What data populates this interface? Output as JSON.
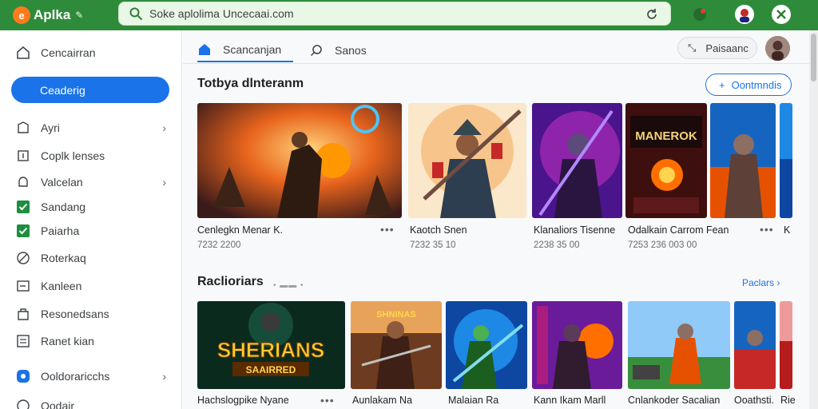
{
  "app": {
    "name": "Aplka",
    "badge": "e"
  },
  "search": {
    "value": "Soke aplolima Uncecaai.com",
    "placeholder": "Soke aplolima Uncecaai.com"
  },
  "sidebar": {
    "primary_label": "Ceaderig",
    "items": [
      {
        "label": "Cencairran",
        "icon": "home-icon"
      },
      {
        "label": "Ayri",
        "icon": "tag-icon",
        "chevron": "›"
      },
      {
        "label": "Coplk lenses",
        "icon": "box-icon"
      },
      {
        "label": "Valcelan",
        "icon": "bell-icon",
        "chevron": "›"
      },
      {
        "label": "Sandang",
        "icon": "check-icon"
      },
      {
        "label": "Paiarha",
        "icon": "check-icon"
      },
      {
        "label": "Roterkaq",
        "icon": "block-icon"
      },
      {
        "label": "Kanleen",
        "icon": "window-icon"
      },
      {
        "label": "Resonedsans",
        "icon": "bag-icon"
      },
      {
        "label": "Ranet kian",
        "icon": "list-icon"
      },
      {
        "label": "Ooldoraricchs",
        "icon": "info-icon",
        "chevron": "›"
      },
      {
        "label": "Oodair",
        "icon": "circle-icon"
      }
    ]
  },
  "tabs": [
    {
      "label": "Scancanjan",
      "icon": "home-icon"
    },
    {
      "label": "Sanos",
      "icon": "search-icon"
    }
  ],
  "header_button": {
    "label": "Paisaanc"
  },
  "section1": {
    "title": "Totbya dlnteranm",
    "action_label": "Oontmndis",
    "cards": [
      {
        "title": "Cenlegkn Menar K.",
        "sub": "7232 2200"
      },
      {
        "title": "Kaotch Snen",
        "sub": "7232 35 10"
      },
      {
        "title": "Klanaliors Tisenne",
        "sub": "2238 35 00"
      },
      {
        "title": "Odalkain Carrom Fean",
        "sub": "7253 236 003 00"
      },
      {
        "title": "K",
        "sub": ""
      }
    ],
    "poster_text": "MANEROK"
  },
  "section2": {
    "title": "Raclioriars",
    "more_label": "Paclars",
    "cards": [
      {
        "title": "Hachslogpike Nyane"
      },
      {
        "title": "Aunlakam Na"
      },
      {
        "title": "Malaian Ra"
      },
      {
        "title": "Kann Ikam Marll"
      },
      {
        "title": "Cnlankoder Sacalian"
      },
      {
        "title": "Ooathsti."
      },
      {
        "title": "Rie"
      }
    ],
    "poster_title": "SHERIANS",
    "poster_sub": "SAAIRRED",
    "poster2_text": "SHNINAS"
  },
  "colors": {
    "brand_green": "#2e8b3a",
    "accent_blue": "#1a73e8",
    "check_green": "#1e8e3e"
  }
}
